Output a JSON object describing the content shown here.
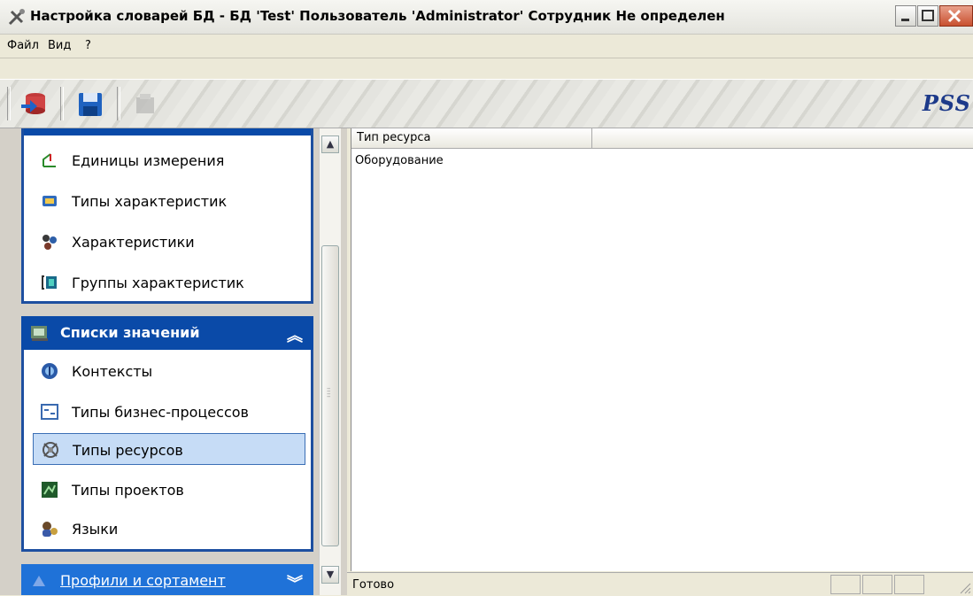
{
  "window": {
    "title": "Настройка словарей БД - БД 'Test' Пользователь 'Administrator' Сотрудник Не определен"
  },
  "menu": {
    "items": [
      "Файл",
      "Вид",
      "?"
    ]
  },
  "toolbar": {
    "buttons": [
      "db-connect-icon",
      "save-icon",
      "disabled-icon"
    ],
    "logo": "PSS"
  },
  "sidebar": {
    "top_group_items": [
      {
        "label": "Единицы измерения",
        "icon": "units-icon"
      },
      {
        "label": "Типы характеристик",
        "icon": "characteristic-types-icon"
      },
      {
        "label": "Характеристики",
        "icon": "characteristics-icon"
      },
      {
        "label": "Группы характеристик",
        "icon": "characteristic-groups-icon"
      }
    ],
    "values_group": {
      "title": "Списки значений",
      "items": [
        {
          "label": "Контексты",
          "icon": "contexts-icon"
        },
        {
          "label": "Типы бизнес-процессов",
          "icon": "business-process-types-icon"
        },
        {
          "label": "Типы ресурсов",
          "icon": "resource-types-icon",
          "selected": true
        },
        {
          "label": "Типы проектов",
          "icon": "project-types-icon"
        },
        {
          "label": "Языки",
          "icon": "languages-icon"
        }
      ]
    },
    "bottom_group": {
      "title": "Профили и сортамент"
    }
  },
  "list": {
    "columns": [
      "Тип ресурса"
    ],
    "rows": [
      "Оборудование"
    ]
  },
  "status": {
    "text": "Готово"
  },
  "colors": {
    "group_header": "#0a4aa8",
    "selection": "#c6dcf6",
    "logo": "#1d3a8a"
  }
}
